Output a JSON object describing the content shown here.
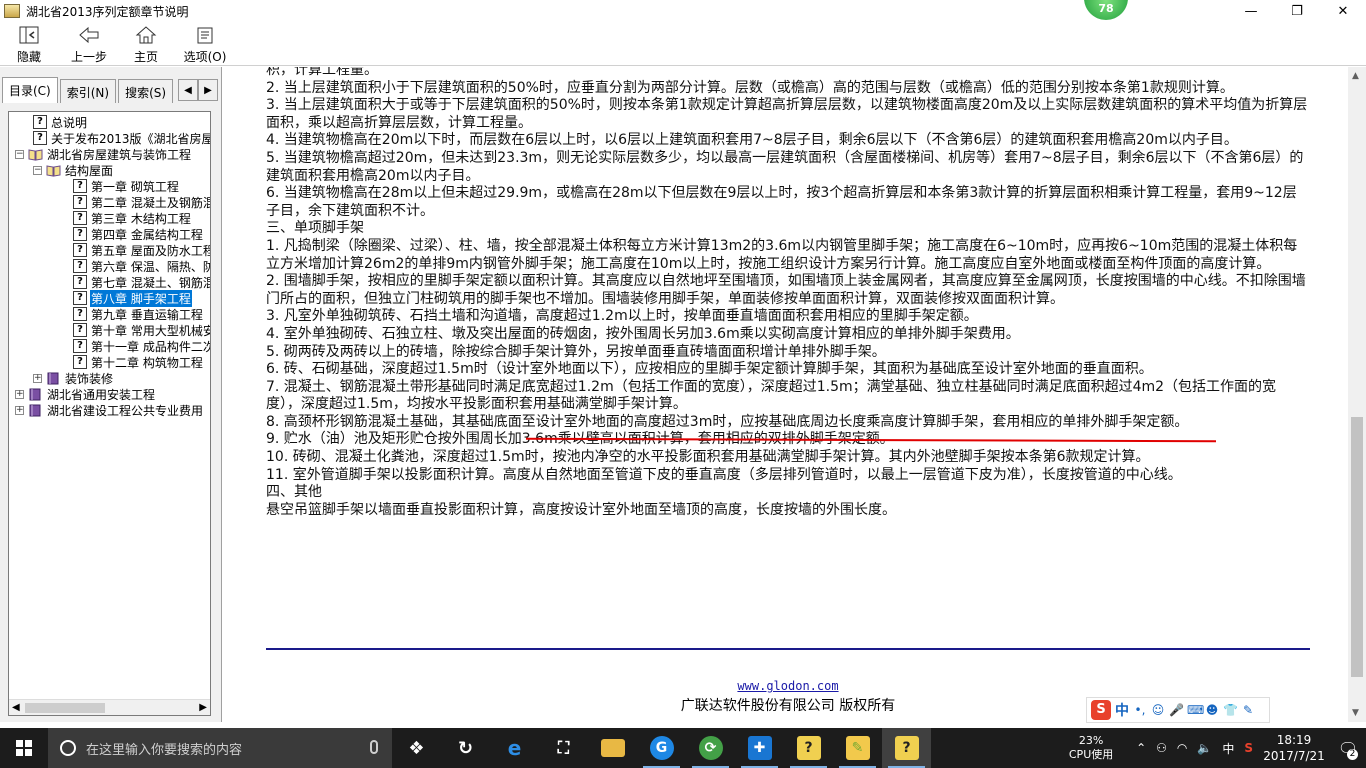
{
  "window": {
    "title": "湖北省2013序列定额章节说明",
    "badge": "78",
    "controls": {
      "minimize": "—",
      "maximize": "❐",
      "close": "✕"
    }
  },
  "toolbar": {
    "buttons": [
      {
        "label": "隐藏"
      },
      {
        "label": "上一步"
      },
      {
        "label": "主页"
      },
      {
        "label": "选项(O)"
      }
    ]
  },
  "tabs": [
    {
      "label": "目录(C)"
    },
    {
      "label": "索引(N)"
    },
    {
      "label": "搜索(S)"
    }
  ],
  "tree": [
    {
      "label": "总说明"
    },
    {
      "label": "关于发布2013版《湖北省房屋"
    },
    {
      "label": "湖北省房屋建筑与装饰工程"
    },
    {
      "label": "结构屋面"
    },
    {
      "label": "第一章 砌筑工程"
    },
    {
      "label": "第二章 混凝土及钢筋混"
    },
    {
      "label": "第三章 木结构工程"
    },
    {
      "label": "第四章 金属结构工程"
    },
    {
      "label": "第五章 屋面及防水工程"
    },
    {
      "label": "第六章 保温、隔热、防"
    },
    {
      "label": "第七章 混凝土、钢筋混"
    },
    {
      "label": "第八章 脚手架工程"
    },
    {
      "label": "第九章 垂直运输工程"
    },
    {
      "label": "第十章 常用大型机械安"
    },
    {
      "label": "第十一章 成品构件二次"
    },
    {
      "label": "第十二章 构筑物工程"
    },
    {
      "label": "装饰装修"
    },
    {
      "label": "湖北省通用安装工程"
    },
    {
      "label": "湖北省建设工程公共专业费用"
    }
  ],
  "content": {
    "paragraphs": [
      "积，计算工程量。",
      "2. 当上层建筑面积小于下层建筑面积的50%时，应垂直分割为两部分计算。层数（或檐高）高的范围与层数（或檐高）低的范围分别按本条第1款规则计算。",
      "3. 当上层建筑面积大于或等于下层建筑面积的50%时，则按本条第1款规定计算超高折算层层数，以建筑物楼面高度20m及以上实际层数建筑面积的算术平均值为折算层面积，乘以超高折算层层数，计算工程量。",
      "4. 当建筑物檐高在20m以下时，而层数在6层以上时，以6层以上建筑面积套用7~8层子目，剩余6层以下（不含第6层）的建筑面积套用檐高20m以内子目。",
      "5. 当建筑物檐高超过20m，但未达到23.3m，则无论实际层数多少，均以最高一层建筑面积（含屋面楼梯间、机房等）套用7~8层子目，剩余6层以下（不含第6层）的建筑面积套用檐高20m以内子目。",
      "6. 当建筑物檐高在28m以上但未超过29.9m，或檐高在28m以下但层数在9层以上时，按3个超高折算层和本条第3款计算的折算层面积相乘计算工程量，套用9~12层子目，余下建筑面积不计。",
      "三、单项脚手架",
      "1. 凡捣制梁（除圈梁、过梁）、柱、墙，按全部混凝土体积每立方米计算13m2的3.6m以内钢管里脚手架；施工高度在6~10m时，应再按6~10m范围的混凝土体积每立方米增加计算26m2的单排9m内钢管外脚手架；施工高度在10m以上时，按施工组织设计方案另行计算。施工高度应自室外地面或楼面至构件顶面的高度计算。",
      "2. 围墙脚手架，按相应的里脚手架定额以面积计算。其高度应以自然地坪至围墙顶，如围墙顶上装金属网者，其高度应算至金属网顶，长度按围墙的中心线。不扣除围墙门所占的面积，但独立门柱砌筑用的脚手架也不增加。围墙装修用脚手架，单面装修按单面面积计算，双面装修按双面面积计算。",
      "3. 凡室外单独砌筑砖、石挡土墙和沟道墙，高度超过1.2m以上时，按单面垂直墙面面积套用相应的里脚手架定额。",
      "4. 室外单独砌砖、石独立柱、墩及突出屋面的砖烟囱，按外围周长另加3.6m乘以实砌高度计算相应的单排外脚手架费用。",
      "5. 砌两砖及两砖以上的砖墙，除按综合脚手架计算外，另按单面垂直砖墙面面积增计单排外脚手架。",
      "6. 砖、石砌基础，深度超过1.5m时（设计室外地面以下），应按相应的里脚手架定额计算脚手架，其面积为基础底至设计室外地面的垂直面积。",
      "7. 混凝土、钢筋混凝土带形基础同时满足底宽超过1.2m（包括工作面的宽度），深度超过1.5m；满堂基础、独立柱基础同时满足底面积超过4m2（包括工作面的宽度），深度超过1.5m，均按水平投影面积套用基础满堂脚手架计算。",
      "8. 高颈杯形钢筋混凝土基础，其基础底面至设计室外地面的高度超过3m时，应按基础底周边长度乘高度计算脚手架，套用相应的单排外脚手架定额。",
      "9. 贮水（油）池及矩形贮仓按外围周长加3.6m乘以壁高以面积计算，套用相应的双排外脚手架定额。",
      "10. 砖砌、混凝土化粪池，深度超过1.5m时，按池内净空的水平投影面积套用基础满堂脚手架计算。其内外池壁脚手架按本条第6款规定计算。",
      "11. 室外管道脚手架以投影面积计算。高度从自然地面至管道下皮的垂直高度（多层排列管道时，以最上一层管道下皮为准），长度按管道的中心线。",
      "四、其他",
      "悬空吊篮脚手架以墙面垂直投影面积计算，高度按设计室外地面至墙顶的高度，长度按墙的外围长度。"
    ],
    "footer_link": "www.glodon.com",
    "footer_copy": "广联达软件股份有限公司 版权所有"
  },
  "ime": {
    "logo": "S",
    "mode": "中"
  },
  "taskbar": {
    "search_placeholder": "在这里输入你要搜索的内容",
    "cpu_percent": "23%",
    "cpu_label": "CPU使用",
    "tray_lang": "中",
    "time": "18:19",
    "date": "2017/7/21",
    "notifications": "2",
    "icons": [
      "task-view-icon",
      "cortana-icon",
      "edge-icon",
      "store-icon",
      "explorer-icon",
      "glodon-icon",
      "sync-icon",
      "tool-icon",
      "help-icon",
      "notes-icon",
      "help-active-icon"
    ]
  },
  "colors": {
    "selection": "#0078d7",
    "underline_red": "#e00000",
    "rule_blue": "#1a1a8a",
    "taskbar": "#1c1c1c"
  }
}
